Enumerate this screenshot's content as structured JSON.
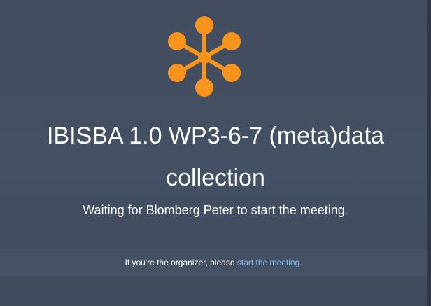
{
  "meeting": {
    "title_line1": "IBISBA 1.0 WP3-6-7 (meta)data",
    "title_line2": "collection",
    "status_text": "Waiting for Blomberg Peter to start the meeting."
  },
  "organizer_prompt": {
    "text": "If you're the organizer, please ",
    "link_label": "start the meeting."
  },
  "logo": {
    "icon": "hub-network-icon",
    "color": "#f7941d"
  },
  "colors": {
    "background": "#434d5f",
    "footer_bar": "#475166",
    "link": "#7fb8f2",
    "accent": "#f7941d"
  }
}
